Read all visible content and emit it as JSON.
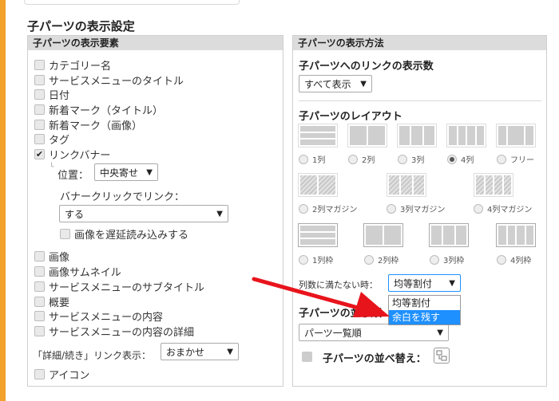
{
  "section_title": "子パーツの表示設定",
  "left": {
    "header": "子パーツの表示要素",
    "items_top": [
      {
        "label": "カテゴリー名",
        "checked": false
      },
      {
        "label": "サービスメニューのタイトル",
        "checked": false
      },
      {
        "label": "日付",
        "checked": false
      },
      {
        "label": "新着マーク（タイトル）",
        "checked": false
      },
      {
        "label": "新着マーク（画像）",
        "checked": false
      },
      {
        "label": "タグ",
        "checked": false
      },
      {
        "label": "リンクバナー",
        "checked": true
      }
    ],
    "position_label": "位置：",
    "position_value": "中央寄せ",
    "banner_click_label": "バナークリックでリンク：",
    "banner_click_value": "する",
    "lazy_load_label": "画像を遅延読み込みする",
    "items_bottom": [
      {
        "label": "画像",
        "checked": false
      },
      {
        "label": "画像サムネイル",
        "checked": false
      },
      {
        "label": "サービスメニューのサブタイトル",
        "checked": false
      },
      {
        "label": "概要",
        "checked": false
      },
      {
        "label": "サービスメニューの内容",
        "checked": false
      },
      {
        "label": "サービスメニューの内容の詳細",
        "checked": false
      }
    ],
    "detail_link_label": "「詳細/続き」リンク表示：",
    "detail_link_value": "おまかせ",
    "icon_label": "アイコン"
  },
  "right": {
    "header": "子パーツの表示方法",
    "link_count_title": "子パーツへのリンクの表示数",
    "link_count_value": "すべて表示",
    "layout_title": "子パーツのレイアウト",
    "layout_row1": [
      "1列",
      "2列",
      "3列",
      "4列",
      "フリー"
    ],
    "layout_row1_selected": 3,
    "layout_row2": [
      "2列マガジン",
      "3列マガジン",
      "4列マガジン"
    ],
    "layout_row3": [
      "1列枠",
      "2列枠",
      "3列枠",
      "4列枠"
    ],
    "fill_label": "列数に満たない時：",
    "fill_value": "均等割付",
    "fill_options": [
      "均等割付",
      "余白を残す"
    ],
    "fill_highlighted": 1,
    "sort_title_partial": "子パーツの並び順",
    "sort_value": "パーツ一覧順",
    "reorder_label": "子パーツの並べ替え："
  },
  "colors": {
    "accent_bar": "#f2a12b",
    "arrow": "#e8141c",
    "highlight": "#1e90ff"
  }
}
